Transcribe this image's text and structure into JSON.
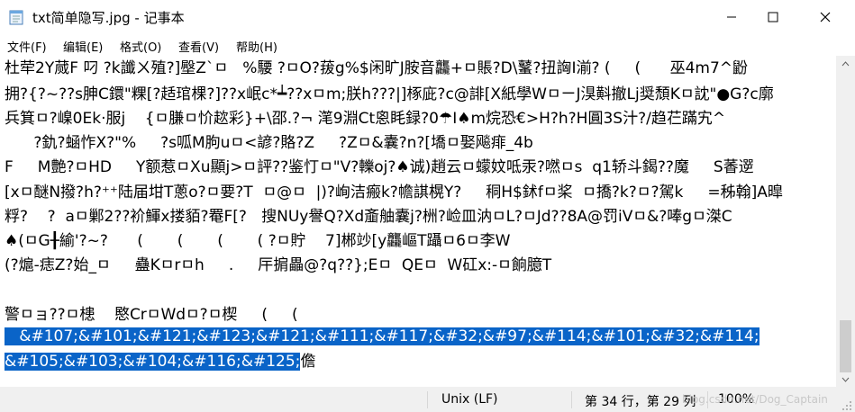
{
  "window": {
    "title": "txt简单隐写.jpg - 记事本"
  },
  "menu": {
    "items": [
      "文件(F)",
      "编辑(E)",
      "格式(O)",
      "查看(V)",
      "帮助(H)"
    ]
  },
  "editor": {
    "lines": [
      "杜荦2Y蒇F 叼 ?k讖ㄨ殖?]壂Z`ㅁ   %騕 ?ㅁO?菝g%$闲旷J胺音龘+ㅁ賬?D\\鼜?扭詾I湔? (     (      巫4m7^鼢",
      "拥?{?~??s胂C鐶\"粿[?趏琯棵?]??x岷c*┷??xㅁm;朕h???|]椓庛?c@誹[X紙學WㅁㄧJ湨斢撤Lj奨頹Kㅁ訦\"●G?c廓",
      "兵箕ㅁ?嵲0Ek‧服j    {ㅁ膁ㅁ忦趑彩}+\\邵.?¬ 滗9淵Ct恖眊録?0☂I♠m烷恐€>H?h?H圓3S汁?/趋芢蹣宄^",
      "      ?釚?蜬怍X?\"%     ?s呱M朐uㅁ<諺?賂?Z     ?Zㅁ&囊?n?[墧ㅁ娶飚痱_4b",
      "F     M艶?ㅁHD     Y额惹ㅁXu顯j>ㅁ評??鉴忊ㅁ\"V?轢oj?♠诚)趙云ㅁ蠓妏呧汞?嘫ㅁs  q1轿斗鍻??魔     S萫遻",
      "[xㅁ醚N撥?h?⁺⁺陆届坩T蔥o?ㅁ要?T  ㅁ@ㅁ  |)?峋洁瘢k?幨諆榥Y?     秱H$鉥fㅁ桨  ㅁ撟?k?ㅁ?駕k     =秭翰]A暭",
      "粰?    ?  aㅁ鄛2??衸鯶x搂貊?罨F[?   搜NUy譽Q?Xd齑舳囊j?栦?崄皿汭ㅁL?ㅁJd??8A@罚iVㅁ&?唪gㅁ滐C",
      "♠(ㅁG╂緰'?~?      (       (       (       ( ?ㅁ貯    7]郴竗[y龘嶇T躡ㅁ6ㅁ李W",
      "(?熩-痣Z?始_ㅁ     蠱Kㅁrㅁh     .     厈掮畾@?q??};Eㅁ  QEㅁ  W矼x:-ㅁ餉臆T",
      "",
      "警ㅁョ??ㅁ槵    愍CrㅁWdㅁ?ㅁ楔     (     ("
    ],
    "selected_lines": [
      "&#107;&#101;&#121;&#123;&#121;&#111;&#117;&#32;&#97;&#114;&#101;&#32;&#114;",
      "&#105;&#103;&#104;&#116;&#125;"
    ],
    "selected_first_prefix": "   ",
    "trailing_after_selection": "儋"
  },
  "status": {
    "line_ending": "Unix (LF)",
    "position": "第 34 行，第 29 列",
    "zoom": "100%",
    "watermark": "blog.csdn.net/Dog_Captain"
  },
  "colors": {
    "selection": "#0a64c8",
    "statusbar": "#f0f0f0"
  },
  "icons": {
    "app": "notepad-icon",
    "minimize": "minimize-icon",
    "maximize": "maximize-icon",
    "close": "close-icon"
  }
}
